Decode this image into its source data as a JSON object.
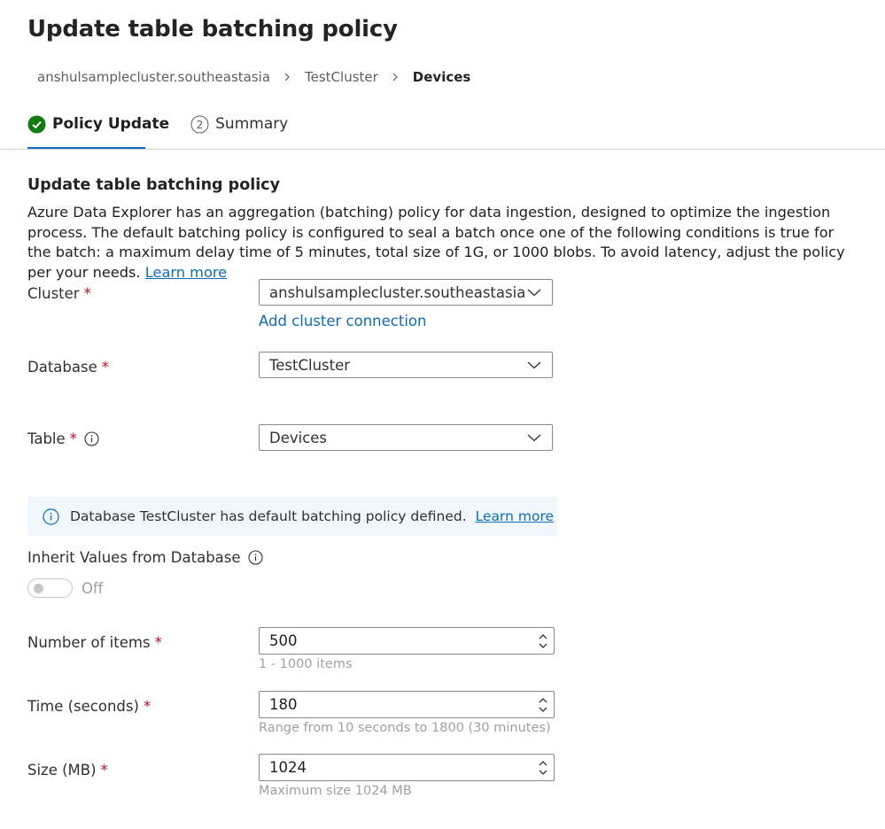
{
  "page": {
    "title": "Update table batching policy"
  },
  "breadcrumb": {
    "items": [
      "anshulsamplecluster.southeastasia",
      "TestCluster",
      "Devices"
    ]
  },
  "tabs": [
    {
      "label": "Policy Update",
      "step": "1",
      "state": "completed"
    },
    {
      "label": "Summary",
      "step": "2",
      "state": "pending"
    }
  ],
  "section": {
    "title": "Update table batching policy",
    "description": "Azure Data Explorer has an aggregation (batching) policy for data ingestion, designed to optimize the ingestion process. The default batching policy is configured to seal a batch once one of the following conditions is true for the batch: a maximum delay time of 5 minutes, total size of 1G, or 1000 blobs. To avoid latency, adjust the policy per your needs.",
    "learn_more": "Learn more"
  },
  "form": {
    "required_mark": "*",
    "cluster": {
      "label": "Cluster",
      "value": "anshulsamplecluster.southeastasia",
      "add_link": "Add cluster connection"
    },
    "database": {
      "label": "Database",
      "value": "TestCluster"
    },
    "table": {
      "label": "Table",
      "value": "Devices"
    },
    "info_bar": {
      "text": "Database TestCluster has default batching policy defined.",
      "link": "Learn more"
    },
    "inherit": {
      "label": "Inherit Values from Database",
      "toggle_state": "Off"
    },
    "items": {
      "label": "Number of items",
      "value": "500",
      "hint": "1 - 1000 items"
    },
    "time": {
      "label": "Time (seconds)",
      "value": "180",
      "hint": "Range from 10 seconds to 1800 (30 minutes)"
    },
    "size": {
      "label": "Size (MB)",
      "value": "1024",
      "hint": "Maximum size 1024 MB"
    }
  },
  "colors": {
    "accent": "#0f6cbd",
    "success": "#107c10",
    "required": "#c50f1f",
    "info_bg": "#eff6fc"
  }
}
